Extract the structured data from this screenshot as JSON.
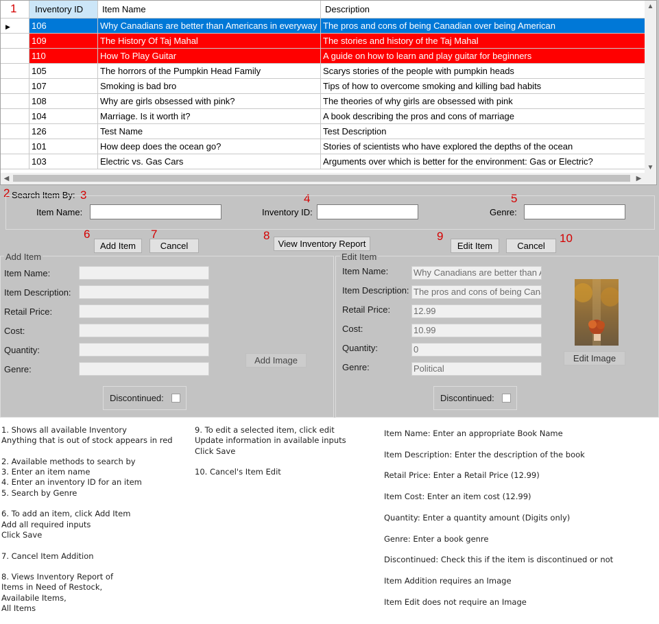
{
  "grid": {
    "columns": [
      "Inventory ID",
      "Item Name",
      "Description"
    ],
    "rows": [
      {
        "id": "106",
        "name": "Why Canadians are better than Americans in everyway",
        "desc": "The pros and cons of being Canadian over being American",
        "state": "selected"
      },
      {
        "id": "109",
        "name": "The History Of Taj Mahal",
        "desc": "The stories and history of the Taj Mahal",
        "state": "out-of-stock"
      },
      {
        "id": "110",
        "name": "How To Play Guitar",
        "desc": "A guide on how to learn and play guitar for beginners",
        "state": "out-of-stock"
      },
      {
        "id": "105",
        "name": "The horrors of the Pumpkin Head Family",
        "desc": "Scarys stories of the people with pumpkin heads",
        "state": "normal"
      },
      {
        "id": "107",
        "name": "Smoking is bad bro",
        "desc": "Tips of how to overcome smoking and killing bad habits",
        "state": "normal"
      },
      {
        "id": "108",
        "name": "Why are girls obsessed with pink?",
        "desc": "The theories of why girls are obsessed with pink",
        "state": "normal"
      },
      {
        "id": "104",
        "name": "Marriage. Is it worth it?",
        "desc": "A book describing the pros and cons of marriage",
        "state": "normal"
      },
      {
        "id": "126",
        "name": "Test Name",
        "desc": "Test Description",
        "state": "normal"
      },
      {
        "id": "101",
        "name": "How deep does the ocean go?",
        "desc": "Stories of scientists who have explored the depths of the ocean",
        "state": "normal"
      },
      {
        "id": "103",
        "name": "Electric vs. Gas Cars",
        "desc": "Arguments over which is better for the environment: Gas or Electric?",
        "state": "normal"
      }
    ],
    "current_row_marker": "▶",
    "scroll_up": "▲",
    "scroll_down": "▼",
    "scroll_left": "◀",
    "scroll_right": "▶"
  },
  "annotations": [
    "1",
    "2",
    "3",
    "4",
    "5",
    "6",
    "7",
    "8",
    "9",
    "10"
  ],
  "search": {
    "title": "Search Item By:",
    "item_name_label": "Item Name:",
    "inventory_id_label": "Inventory ID:",
    "genre_label": "Genre:"
  },
  "buttons": {
    "add_item": "Add Item",
    "cancel_add": "Cancel",
    "view_report": "View Inventory Report",
    "edit_item": "Edit Item",
    "cancel_edit": "Cancel",
    "add_image": "Add Image",
    "edit_image": "Edit Image"
  },
  "add_item": {
    "title": "Add Item",
    "labels": [
      "Item Name:",
      "Item Description:",
      "Retail Price:",
      "Cost:",
      "Quantity:",
      "Genre:"
    ],
    "discontinued_label": "Discontinued:"
  },
  "edit_item": {
    "title": "Edit Item",
    "labels": [
      "Item Name:",
      "Item Description:",
      "Retail Price:",
      "Cost:",
      "Quantity:",
      "Genre:"
    ],
    "values": [
      "Why Canadians are better than A",
      "The pros and cons of being Cana",
      "12.99",
      "10.99",
      "0",
      "Political"
    ],
    "discontinued_label": "Discontinued:"
  },
  "colors": {
    "selected_row": "#0078d7",
    "out_of_stock_row": "#ff0000",
    "annotation": "#d40000",
    "form_background": "#c3c3c3"
  },
  "notes": {
    "col1": [
      "1. Shows all available Inventory",
      "Anything that is out of stock appears in red",
      "",
      "2. Available methods to search by",
      "3. Enter an item name",
      "4. Enter an inventory ID for an item",
      "5. Search by Genre",
      "",
      "6. To add an item, click Add Item",
      "Add all required inputs",
      "Click Save",
      "",
      "7. Cancel Item Addition",
      "",
      "8. Views Inventory Report of",
      "Items in Need of Restock,",
      "Availabile Items,",
      "All Items"
    ],
    "col2": [
      "9. To edit a selected item, click edit",
      "Update information in available inputs",
      "Click Save",
      "",
      "10. Cancel's Item Edit"
    ],
    "col3": [
      "Item Name: Enter an appropriate Book Name",
      "Item Description: Enter the description of the book",
      "Retail Price: Enter a Retail Price (12.99)",
      "Item Cost: Enter an item cost (12.99)",
      "Quantity: Enter a quantity amount (Digits only)",
      "Genre: Enter a book genre",
      "Discontinued: Check this if the item is discontinued or not",
      "Item Addition requires an Image",
      "Item Edit does not require an Image"
    ]
  }
}
